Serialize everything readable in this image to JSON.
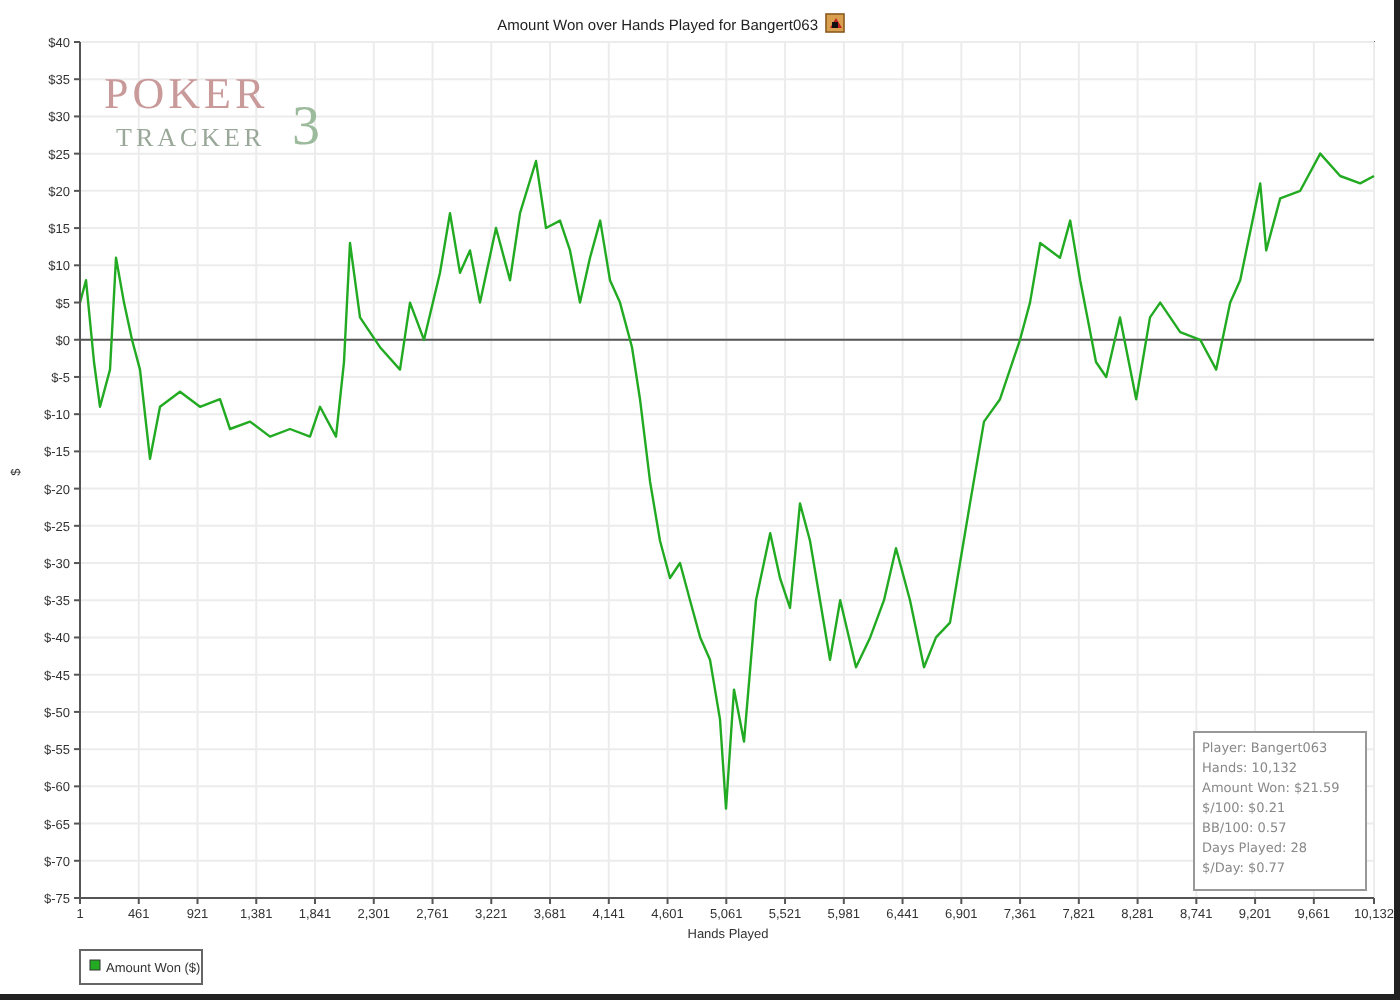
{
  "title": "Amount Won over Hands Played for Bangert063",
  "logo": {
    "word": "POKER",
    "sub": "TRACKER",
    "mark": "3"
  },
  "chart_data": {
    "type": "line",
    "grid": true,
    "xlabel": "Hands Played",
    "ylabel": "$",
    "xlim": [
      1,
      10132
    ],
    "ylim": [
      -75,
      40
    ],
    "x": [
      1,
      48,
      111,
      158,
      236,
      283,
      346,
      408,
      471,
      549,
      627,
      784,
      941,
      1097,
      1175,
      1332,
      1489,
      1645,
      1802,
      1880,
      2005,
      2068,
      2115,
      2193,
      2350,
      2506,
      2585,
      2694,
      2820,
      2898,
      2976,
      3055,
      3133,
      3258,
      3368,
      3446,
      3571,
      3650,
      3759,
      3838,
      3916,
      3994,
      4073,
      4151,
      4229,
      4323,
      4386,
      4464,
      4542,
      4621,
      4699,
      4777,
      4856,
      4934,
      5012,
      5059,
      5122,
      5200,
      5294,
      5404,
      5482,
      5560,
      5638,
      5717,
      5795,
      5873,
      5952,
      6077,
      6187,
      6296,
      6390,
      6500,
      6609,
      6703,
      6813,
      6891,
      6969,
      7079,
      7204,
      7361,
      7439,
      7518,
      7674,
      7753,
      7831,
      7956,
      8035,
      8144,
      8270,
      8379,
      8458,
      8614,
      8771,
      8896,
      9006,
      9084,
      9241,
      9288,
      9398,
      9554,
      9711,
      9867,
      10024,
      10132
    ],
    "series": [
      {
        "name": "Amount Won ($)",
        "color": "#22aa22",
        "values": [
          5,
          8,
          -3,
          -9,
          -4,
          11,
          5,
          0,
          -4,
          -16,
          -9,
          -7,
          -9,
          -8,
          -12,
          -11,
          -13,
          -12,
          -13,
          -9,
          -13,
          -3,
          13,
          3,
          -1,
          -4,
          5,
          0,
          9,
          17,
          9,
          12,
          5,
          15,
          8,
          17,
          24,
          15,
          16,
          12,
          5,
          11,
          16,
          8,
          5,
          -1,
          -8,
          -19,
          -27,
          -32,
          -30,
          -35,
          -40,
          -43,
          -51,
          -63,
          -47,
          -54,
          -35,
          -26,
          -32,
          -36,
          -22,
          -27,
          -35,
          -43,
          -35,
          -44,
          -40,
          -35,
          -28,
          -35,
          -44,
          -40,
          -38,
          -30,
          -22,
          -11,
          -8,
          0,
          5,
          13,
          11,
          16,
          8,
          -3,
          -5,
          3,
          -8,
          3,
          5,
          1,
          0,
          -4,
          5,
          8,
          21,
          12,
          19,
          20,
          25,
          22,
          21,
          22
        ]
      }
    ],
    "xticks": [
      {
        "value": 1,
        "label": "1"
      },
      {
        "value": 461,
        "label": "461"
      },
      {
        "value": 921,
        "label": "921"
      },
      {
        "value": 1381,
        "label": "1,381"
      },
      {
        "value": 1841,
        "label": "1,841"
      },
      {
        "value": 2301,
        "label": "2,301"
      },
      {
        "value": 2761,
        "label": "2,761"
      },
      {
        "value": 3221,
        "label": "3,221"
      },
      {
        "value": 3681,
        "label": "3,681"
      },
      {
        "value": 4141,
        "label": "4,141"
      },
      {
        "value": 4601,
        "label": "4,601"
      },
      {
        "value": 5061,
        "label": "5,061"
      },
      {
        "value": 5521,
        "label": "5,521"
      },
      {
        "value": 5981,
        "label": "5,981"
      },
      {
        "value": 6441,
        "label": "6,441"
      },
      {
        "value": 6901,
        "label": "6,901"
      },
      {
        "value": 7361,
        "label": "7,361"
      },
      {
        "value": 7821,
        "label": "7,821"
      },
      {
        "value": 8281,
        "label": "8,281"
      },
      {
        "value": 8741,
        "label": "8,741"
      },
      {
        "value": 9201,
        "label": "9,201"
      },
      {
        "value": 9661,
        "label": "9,661"
      },
      {
        "value": 10132,
        "label": "10,132"
      }
    ],
    "yticks": [
      {
        "value": 40,
        "label": "$40"
      },
      {
        "value": 35,
        "label": "$35"
      },
      {
        "value": 30,
        "label": "$30"
      },
      {
        "value": 25,
        "label": "$25"
      },
      {
        "value": 20,
        "label": "$20"
      },
      {
        "value": 15,
        "label": "$15"
      },
      {
        "value": 10,
        "label": "$10"
      },
      {
        "value": 5,
        "label": "$5"
      },
      {
        "value": 0,
        "label": "$0"
      },
      {
        "value": -5,
        "label": "$-5"
      },
      {
        "value": -10,
        "label": "$-10"
      },
      {
        "value": -15,
        "label": "$-15"
      },
      {
        "value": -20,
        "label": "$-20"
      },
      {
        "value": -25,
        "label": "$-25"
      },
      {
        "value": -30,
        "label": "$-30"
      },
      {
        "value": -35,
        "label": "$-35"
      },
      {
        "value": -40,
        "label": "$-40"
      },
      {
        "value": -45,
        "label": "$-45"
      },
      {
        "value": -50,
        "label": "$-50"
      },
      {
        "value": -55,
        "label": "$-55"
      },
      {
        "value": -60,
        "label": "$-60"
      },
      {
        "value": -65,
        "label": "$-65"
      },
      {
        "value": -70,
        "label": "$-70"
      },
      {
        "value": -75,
        "label": "$-75"
      }
    ]
  },
  "stats_box": [
    "Player: Bangert063",
    "Hands: 10,132",
    "Amount Won: $21.59",
    "$/100: $0.21",
    "BB/100: 0.57",
    "Days Played: 28",
    "$/Day: $0.77"
  ]
}
